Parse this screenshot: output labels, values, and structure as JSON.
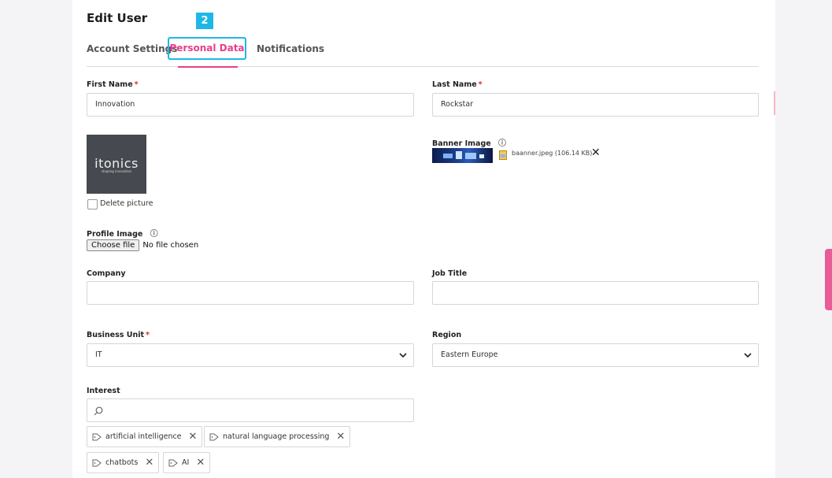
{
  "header": {
    "title": "Edit User",
    "step_badge": "2"
  },
  "tabs": [
    {
      "label": "Account Settings",
      "active": false
    },
    {
      "label": "Personal Data",
      "active": true
    },
    {
      "label": "Notifications",
      "active": false
    }
  ],
  "colors": {
    "accent_pink": "#e83e8c",
    "highlight_blue": "#1eb8e6",
    "logo_bg": "#464a50"
  },
  "form": {
    "first_name": {
      "label": "First Name",
      "required": "*",
      "value": "Innovation"
    },
    "last_name": {
      "label": "Last Name",
      "required": "*",
      "value": "Rockstar"
    },
    "picture": {
      "logo_text": "itonics",
      "logo_subtext": "shaping innovation",
      "delete_label": "Delete picture"
    },
    "banner_image": {
      "label": "Banner Image",
      "help_icon": "question-circle-icon",
      "file_name": "baanner.jpeg",
      "file_size": "(106.14 KB)",
      "remove_icon": "close-icon"
    },
    "profile_image": {
      "label": "Profile Image",
      "help_icon": "question-circle-icon",
      "button_label": "Choose file",
      "status": "No file chosen"
    },
    "company": {
      "label": "Company",
      "value": ""
    },
    "job_title": {
      "label": "Job Title",
      "value": ""
    },
    "business_unit": {
      "label": "Business Unit",
      "required": "*",
      "value": "IT"
    },
    "region": {
      "label": "Region",
      "value": "Eastern Europe"
    },
    "interest": {
      "label": "Interest",
      "search_icon": "search-icon",
      "tags": [
        {
          "label": "artificial intelligence"
        },
        {
          "label": "natural language processing"
        },
        {
          "label": "chatbots"
        },
        {
          "label": "AI"
        }
      ],
      "tag_icon": "tag-icon",
      "remove_icon": "close-icon"
    }
  }
}
